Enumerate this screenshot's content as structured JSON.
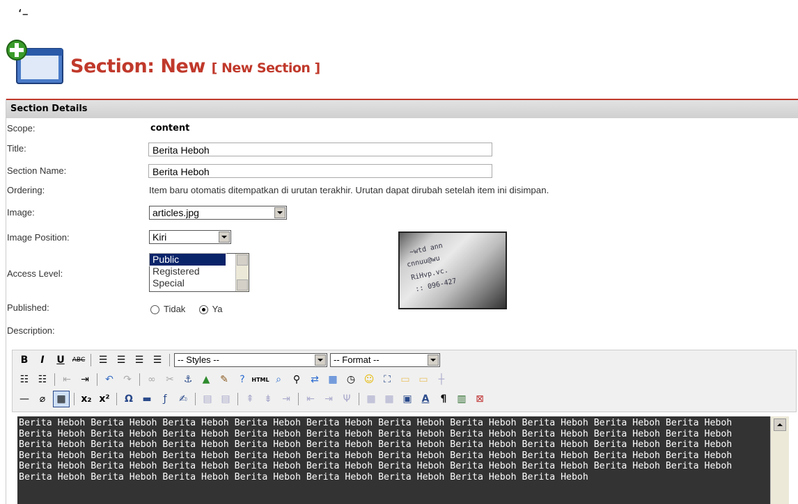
{
  "top_mark": "‘–",
  "header": {
    "title": "Section:",
    "title_new": "New",
    "subtitle": "[ New Section ]"
  },
  "panel": {
    "heading": "Section Details"
  },
  "fields": {
    "scope_label": "Scope:",
    "scope_value": "content",
    "title_label": "Title:",
    "title_value": "Berita Heboh",
    "section_name_label": "Section Name:",
    "section_name_value": "Berita Heboh",
    "ordering_label": "Ordering:",
    "ordering_value": "Item baru otomatis ditempatkan di urutan terakhir. Urutan dapat dirubah setelah item ini disimpan.",
    "image_label": "Image:",
    "image_value": "articles.jpg",
    "image_position_label": "Image Position:",
    "image_position_value": "Kiri",
    "access_level_label": "Access Level:",
    "access_options": [
      "Public",
      "Registered",
      "Special"
    ],
    "published_label": "Published:",
    "published_no": "Tidak",
    "published_yes": "Ya",
    "description_label": "Description:"
  },
  "toolbar": {
    "styles_value": "-- Styles --",
    "format_value": "-- Format --",
    "html_label": "HTML"
  },
  "editor": {
    "content": "Berita Heboh Berita Heboh Berita Heboh Berita Heboh Berita Heboh Berita Heboh Berita Heboh Berita Heboh Berita Heboh Berita Heboh Berita Heboh Berita Heboh Berita Heboh Berita Heboh Berita Heboh Berita Heboh Berita Heboh Berita Heboh Berita Heboh Berita Heboh Berita Heboh Berita Heboh Berita Heboh Berita Heboh Berita Heboh Berita Heboh Berita Heboh Berita Heboh Berita Heboh Berita Heboh Berita Heboh Berita Heboh Berita Heboh Berita Heboh Berita Heboh Berita Heboh Berita Heboh Berita Heboh Berita Heboh Berita Heboh Berita Heboh Berita Heboh Berita Heboh Berita Heboh Berita Heboh Berita Heboh Berita Heboh Berita Heboh Berita Heboh Berita Heboh Berita Heboh Berita Heboh Berita Heboh Berita Heboh Berita Heboh Berita Heboh Berita Heboh Berita Heboh"
  },
  "colors": {
    "accent": "#c0392b",
    "editor_bg": "#333333",
    "selection": "#0a246a"
  }
}
